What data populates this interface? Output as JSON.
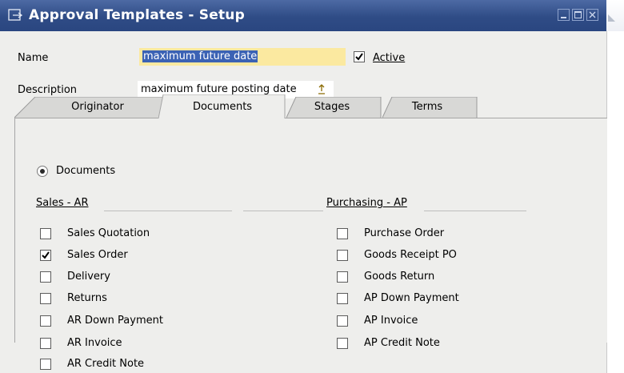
{
  "window": {
    "title": "Approval Templates - Setup"
  },
  "name_field": {
    "label": "Name",
    "value": "maximum future date"
  },
  "active": {
    "label": "Active",
    "checked": true
  },
  "description_field": {
    "label": "Description",
    "value": "maximum future posting date"
  },
  "tabs": [
    {
      "label": "Originator",
      "active": false
    },
    {
      "label": "Documents",
      "active": true
    },
    {
      "label": "Stages",
      "active": false
    },
    {
      "label": "Terms",
      "active": false
    }
  ],
  "documents_radio": {
    "label": "Documents",
    "selected": true
  },
  "sales": {
    "header": "Sales - AR",
    "items": [
      {
        "label": "Sales Quotation",
        "checked": false
      },
      {
        "label": "Sales Order",
        "checked": true
      },
      {
        "label": "Delivery",
        "checked": false
      },
      {
        "label": "Returns",
        "checked": false
      },
      {
        "label": "AR Down Payment",
        "checked": false
      },
      {
        "label": "AR Invoice",
        "checked": false
      },
      {
        "label": "AR Credit Note",
        "checked": false
      }
    ]
  },
  "purchasing": {
    "header": "Purchasing - AP",
    "items": [
      {
        "label": "Purchase Order",
        "checked": false
      },
      {
        "label": "Goods Receipt PO",
        "checked": false
      },
      {
        "label": "Goods Return",
        "checked": false
      },
      {
        "label": "AP Down Payment",
        "checked": false
      },
      {
        "label": "AP Invoice",
        "checked": false
      },
      {
        "label": "AP Credit Note",
        "checked": false
      }
    ]
  },
  "colors": {
    "titlebar": "#2f4c86",
    "name_field_bg": "#fbe9a0",
    "selection": "#3b62b4",
    "form_bg": "#eeeeec"
  }
}
